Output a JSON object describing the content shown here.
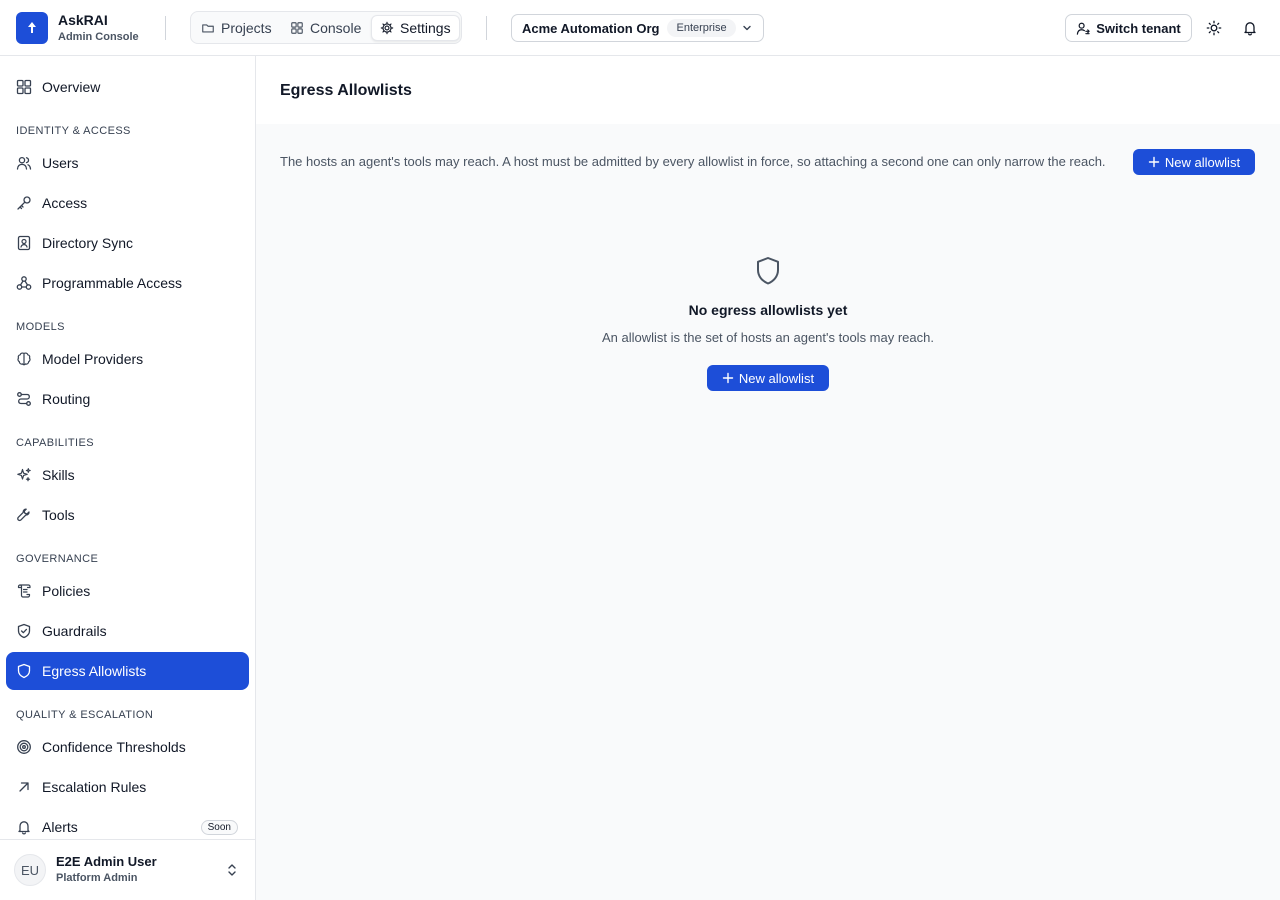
{
  "brand": {
    "name": "AskRAI",
    "subtitle": "Admin Console"
  },
  "nav_tabs": [
    {
      "label": "Projects",
      "icon": "folder-icon"
    },
    {
      "label": "Console",
      "icon": "grid-icon"
    },
    {
      "label": "Settings",
      "icon": "gear-icon",
      "active": true
    }
  ],
  "org": {
    "name": "Acme Automation Org",
    "badge": "Enterprise"
  },
  "header_actions": {
    "switch_tenant": "Switch tenant"
  },
  "sidebar": {
    "overview": "Overview",
    "sections": {
      "identity": "IDENTITY & ACCESS",
      "models": "MODELS",
      "capabilities": "CAPABILITIES",
      "governance": "GOVERNANCE",
      "quality": "QUALITY & ESCALATION"
    },
    "items": {
      "users": "Users",
      "access": "Access",
      "directory_sync": "Directory Sync",
      "programmable_access": "Programmable Access",
      "model_providers": "Model Providers",
      "routing": "Routing",
      "skills": "Skills",
      "tools": "Tools",
      "policies": "Policies",
      "guardrails": "Guardrails",
      "egress_allowlists": "Egress Allowlists",
      "confidence_thresholds": "Confidence Thresholds",
      "escalation_rules": "Escalation Rules",
      "alerts": "Alerts"
    },
    "alerts_badge": "Soon",
    "active_item": "egress_allowlists"
  },
  "user": {
    "initials": "EU",
    "name": "E2E Admin User",
    "role": "Platform Admin"
  },
  "page": {
    "title": "Egress Allowlists",
    "description": "The hosts an agent's tools may reach. A host must be admitted by every allowlist in force, so attaching a second one can only narrow the reach.",
    "new_button": "New allowlist",
    "empty_title": "No egress allowlists yet",
    "empty_subtitle": "An allowlist is the set of hosts an agent's tools may reach.",
    "empty_button": "New allowlist"
  },
  "colors": {
    "accent": "#1d4ed8",
    "border": "#e5e7eb",
    "muted_text": "#4b5563"
  }
}
